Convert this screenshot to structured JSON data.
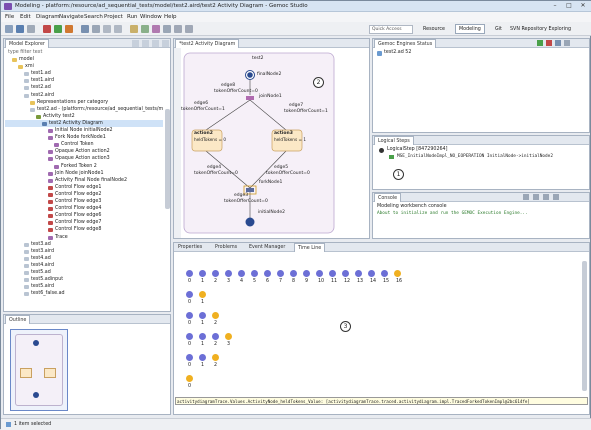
{
  "window": {
    "title": "Modeling - platform:/resource/ad_sequential_tests/model/test2.aird/test2 Activity Diagram - Gemoc Studio"
  },
  "menu": [
    "File",
    "Edit",
    "Diagram",
    "Navigate",
    "Search",
    "Project",
    "Run",
    "Window",
    "Help"
  ],
  "quick_access": {
    "placeholder": "Quick Access"
  },
  "perspectives": [
    "Resource",
    "Modeling",
    "Git",
    "SVN Repository Exploring"
  ],
  "model_explorer": {
    "tab": "Model Explorer",
    "filter": "type filter text",
    "items": [
      {
        "label": "model",
        "icon": "folder-icon"
      },
      {
        "label": "xmi",
        "icon": "folder-icon"
      },
      {
        "label": "test1.ad",
        "icon": "file-icon"
      },
      {
        "label": "test1.aird",
        "icon": "file-icon"
      },
      {
        "label": "test2.ad",
        "icon": "file-icon"
      },
      {
        "label": "test2.aird",
        "icon": "file-icon"
      },
      {
        "label": "Representations per category",
        "icon": "folder-icon"
      },
      {
        "label": "test2.ad - (platform:/resource/ad_sequential_tests/m",
        "icon": "file-icon"
      },
      {
        "label": "Activity test2",
        "icon": "activity-icon"
      },
      {
        "label": "test2 Activity Diagram",
        "icon": "diagram-icon"
      },
      {
        "label": "Initial Node initialNode2",
        "icon": "node-icon"
      },
      {
        "label": "Fork Node forkNode1",
        "icon": "node-icon"
      },
      {
        "label": "Control Token",
        "icon": "node-icon"
      },
      {
        "label": "Opaque Action action2",
        "icon": "node-icon"
      },
      {
        "label": "Opaque Action action3",
        "icon": "node-icon"
      },
      {
        "label": "Forked Token 2",
        "icon": "node-icon"
      },
      {
        "label": "Join Node joinNode1",
        "icon": "node-icon"
      },
      {
        "label": "Activity Final Node finalNode2",
        "icon": "node-icon"
      },
      {
        "label": "Control Flow edge1",
        "icon": "edge-icon"
      },
      {
        "label": "Control Flow edge2",
        "icon": "edge-icon"
      },
      {
        "label": "Control Flow edge3",
        "icon": "edge-icon"
      },
      {
        "label": "Control Flow edge4",
        "icon": "edge-icon"
      },
      {
        "label": "Control Flow edge6",
        "icon": "edge-icon"
      },
      {
        "label": "Control Flow edge7",
        "icon": "edge-icon"
      },
      {
        "label": "Control Flow edge8",
        "icon": "edge-icon"
      },
      {
        "label": "Trace",
        "icon": "node-icon"
      },
      {
        "label": "test3.ad",
        "icon": "file-icon"
      },
      {
        "label": "test3.aird",
        "icon": "file-icon"
      },
      {
        "label": "test4.ad",
        "icon": "file-icon"
      },
      {
        "label": "test4.aird",
        "icon": "file-icon"
      },
      {
        "label": "test5.ad",
        "icon": "file-icon"
      },
      {
        "label": "test5.adinput",
        "icon": "file-icon"
      },
      {
        "label": "test5.aird",
        "icon": "file-icon"
      },
      {
        "label": "test6_false.ad",
        "icon": "file-icon"
      }
    ]
  },
  "outline": {
    "tab": "Outline"
  },
  "diagram": {
    "tab": "*test2 Activity Diagram",
    "activity": "test2",
    "finalNode": "finalNode2",
    "joinNode": "joinNode1",
    "forkNode": "forkNode1",
    "initialNode": "initialNode2",
    "edge8": "edge8",
    "edge8_tok": "tokenOfferCount=0",
    "edge6": "edge6",
    "edge6_tok": "tokenOfferCount=1",
    "edge7": "edge7",
    "edge7_tok": "tokenOfferCount=1",
    "action2": "action2",
    "action2_tok": "heldTokens = 0",
    "action3": "action3",
    "action3_tok": "heldTokens = 1",
    "edge4": "edge4",
    "edge4_tok": "tokenOfferCount=0",
    "edge5": "edge5",
    "edge5_tok": "tokenOfferCount=0",
    "edge3": "edge3",
    "edge3_tok": "tokenOfferCount=0",
    "marker": "2"
  },
  "engines": {
    "tab": "Gemoc Engines Status",
    "row": "test2.ad  52"
  },
  "logical_steps": {
    "tab": "Logical Steps",
    "root": "LogicalStep [847290264]",
    "child": "MSE_InitialNodeImpl_NO_EOPERATION   InitialNode->initialNode2",
    "marker": "1"
  },
  "console": {
    "tab": "Console",
    "header": "Modeling workbench console",
    "line": "About to initialize and run the GEMOC Execution Engine..."
  },
  "bottom_tabs": [
    "Properties",
    "Problems",
    "Event Manager",
    "Time Line"
  ],
  "timeline": {
    "row1_numbers": [
      "0",
      "1",
      "2",
      "3",
      "4",
      "5",
      "6",
      "7",
      "8",
      "9",
      "10",
      "11",
      "12",
      "13",
      "14",
      "15",
      "16"
    ],
    "row2_numbers": [
      "0",
      "1"
    ],
    "row3_numbers": [
      "0",
      "1",
      "2"
    ],
    "row4_numbers": [
      "0",
      "1",
      "2",
      "3"
    ],
    "row5_numbers": [
      "0",
      "1",
      "2"
    ],
    "row6_numbers": [
      "0"
    ],
    "tooltip": "activitydiagramTrace.Values.ActivityNode_heldTokens_Value: [activitydiagramTrace.traced.activitydiagram.impl.TracedForkedTokenImpl@2bc614fe]",
    "marker": "3"
  },
  "status": {
    "text": "1 item selected"
  },
  "colors": {
    "accent": "#6c6fd6",
    "highlight": "#f0b020",
    "selection": "#cfe2f7"
  }
}
